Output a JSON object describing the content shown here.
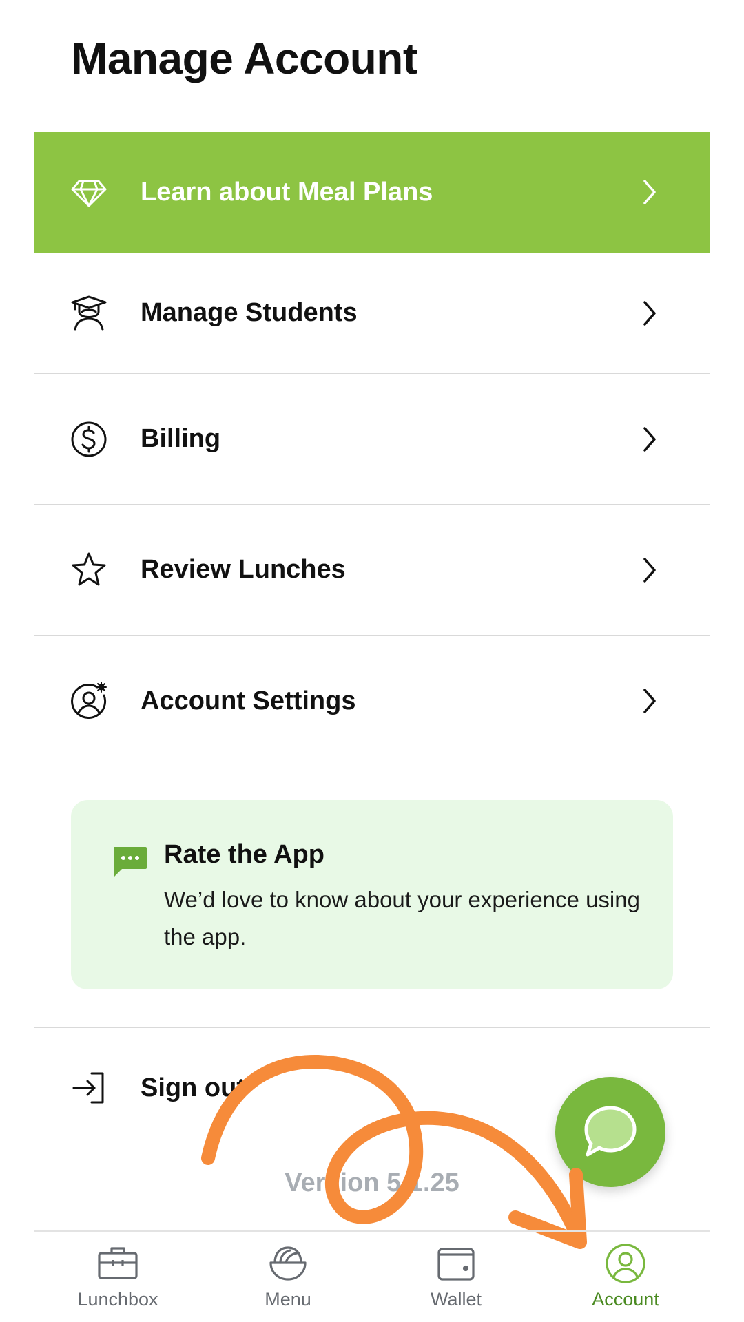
{
  "header": {
    "title": "Manage Account"
  },
  "menu": {
    "meal_plans": "Learn about Meal Plans",
    "students": "Manage Students",
    "billing": "Billing",
    "reviews": "Review Lunches",
    "settings": "Account Settings"
  },
  "rate_card": {
    "title": "Rate the App",
    "description": "We’d love to know about your experience using the app."
  },
  "sign_out": {
    "label": "Sign out"
  },
  "version": {
    "text": "Version 5.1.25"
  },
  "tabs": [
    {
      "label": "Lunchbox",
      "icon": "lunchbox-icon"
    },
    {
      "label": "Menu",
      "icon": "bowl-icon"
    },
    {
      "label": "Wallet",
      "icon": "wallet-icon"
    },
    {
      "label": "Account",
      "icon": "account-icon",
      "active": true
    }
  ],
  "colors": {
    "accent_green": "#8dc443",
    "fab_green": "#79b83e",
    "card_bg": "#e8f9e6",
    "annotation_orange": "#f68b3a",
    "active_tab": "#4a8a21"
  }
}
